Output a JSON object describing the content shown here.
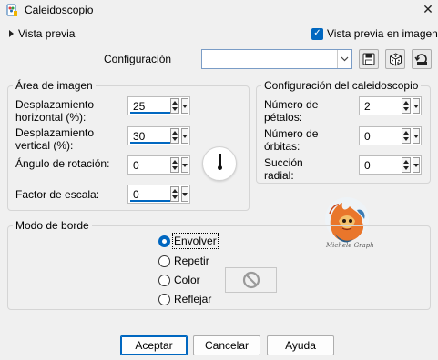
{
  "window": {
    "title": "Caleidoscopio",
    "close_glyph": "✕"
  },
  "preview": {
    "toggle_label": "Vista previa",
    "checkbox_label": "Vista previa en imagen",
    "checked": true
  },
  "config": {
    "label": "Configuración",
    "value": ""
  },
  "image_area": {
    "title": "Área de imagen",
    "h_offset_label": "Desplazamiento horizontal (%):",
    "h_offset_line1": "Desplazamiento",
    "h_offset_line2": "horizontal (%):",
    "h_offset_value": "25",
    "v_offset_line1": "Desplazamiento",
    "v_offset_line2": "vertical (%):",
    "v_offset_value": "30",
    "rotation_label": "Ángulo de rotación:",
    "rotation_value": "0",
    "scale_label": "Factor de escala:",
    "scale_value": "0"
  },
  "kaleido": {
    "title": "Configuración del caleidoscopio",
    "petals_line1": "Número de",
    "petals_line2": "pétalos:",
    "petals_value": "2",
    "orbits_line1": "Número de",
    "orbits_line2": "órbitas:",
    "orbits_value": "0",
    "radial_line1": "Succión",
    "radial_line2": "radial:",
    "radial_value": "0"
  },
  "edge_mode": {
    "title": "Modo de borde",
    "options": [
      "Envolver",
      "Repetir",
      "Color",
      "Reflejar"
    ],
    "selected": "Envolver"
  },
  "watermark": {
    "text": "Michele Graph"
  },
  "buttons": {
    "ok": "Aceptar",
    "cancel": "Cancelar",
    "help": "Ayuda"
  },
  "colors": {
    "accent": "#0067c0",
    "background": "#f0f0f0"
  },
  "icons": [
    "paint-app-icon",
    "close-icon",
    "expand-triangle-icon",
    "check-icon",
    "dropdown-arrow-icon",
    "save-icon",
    "random-dice-icon",
    "reset-icon",
    "rotation-dial-icon",
    "no-color-icon"
  ]
}
